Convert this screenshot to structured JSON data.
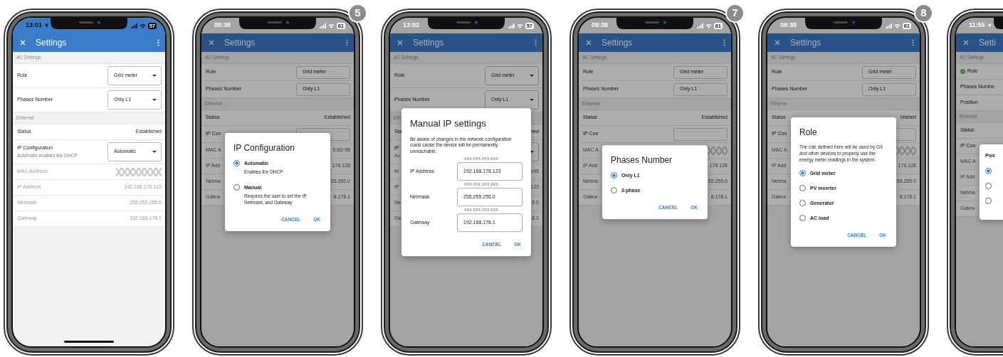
{
  "phones": [
    {
      "status_bar": {
        "time": "13:01",
        "location_arrow": true,
        "battery": "57"
      },
      "app_bar": {
        "title": "Settings"
      },
      "rows": [
        {
          "kind": "section",
          "label": "AC Settings"
        },
        {
          "kind": "dropdown",
          "label": "Role",
          "value": "Grid meter",
          "disabled": false
        },
        {
          "kind": "dropdown",
          "label": "Phases Number",
          "value": "Only L1",
          "disabled": false
        },
        {
          "kind": "section",
          "label": "Ethernet"
        },
        {
          "kind": "text",
          "label": "Status",
          "value": "Established",
          "disabled": false
        },
        {
          "kind": "dropdown",
          "label": "IP Configuration",
          "sublabel": "Automatic enables the DHCP",
          "value": "Automatic",
          "disabled": false
        },
        {
          "kind": "masked",
          "label": "MAC Address",
          "disabled": true
        },
        {
          "kind": "text",
          "label": "IP Address",
          "value": "192.168.178.123",
          "disabled": true
        },
        {
          "kind": "text",
          "label": "Netmask",
          "value": "255.255.255.0",
          "disabled": true
        },
        {
          "kind": "text",
          "label": "Gateway",
          "value": "192.168.178.1",
          "disabled": true
        }
      ]
    },
    {
      "step": "5",
      "status_bar": {
        "time": "09:38",
        "location_arrow": false,
        "battery": "61"
      },
      "app_bar": {
        "title": "Settings"
      },
      "rows": [
        {
          "kind": "section",
          "label": "AC Settings"
        },
        {
          "kind": "field",
          "label": "Role",
          "value": "Grid meter",
          "disabled": false
        },
        {
          "kind": "field",
          "label": "Phases Number",
          "value": "Only L1",
          "disabled": false
        },
        {
          "kind": "section",
          "label": "Ethernet"
        },
        {
          "kind": "text",
          "label": "Status",
          "value": "Established",
          "disabled": false
        },
        {
          "kind": "field",
          "label": "IP Con",
          "disabled": false
        },
        {
          "kind": "text",
          "label": "MAC A",
          "value": "5:8D:95",
          "disabled": true
        },
        {
          "kind": "text",
          "label": "IP Add",
          "value": "178.128",
          "disabled": true
        },
        {
          "kind": "text",
          "label": "Netma",
          "value": "55.255.0",
          "disabled": true
        },
        {
          "kind": "text",
          "label": "Gatew",
          "value": "8.178.1",
          "disabled": true
        }
      ],
      "dialog": {
        "kind": "radio",
        "title": "IP Configuration",
        "options": [
          {
            "label": "Automatic",
            "description": "Enables the DHCP",
            "selected": true
          },
          {
            "label": "Manual",
            "description": "Requires the user to set the IP, Netmask, and Gateway",
            "selected": false
          }
        ],
        "buttons": [
          "CANCEL",
          "OK"
        ]
      }
    },
    {
      "status_bar": {
        "time": "13:02",
        "location_arrow": false,
        "battery": "57"
      },
      "app_bar": {
        "title": "Settings"
      },
      "rows": [
        {
          "kind": "section",
          "label": "AC Settings"
        },
        {
          "kind": "dropdown",
          "label": "Role",
          "value": "Grid meter",
          "disabled": false
        },
        {
          "kind": "dropdown",
          "label": "Phases Number",
          "value": "Only L1",
          "disabled": false
        },
        {
          "kind": "section",
          "label": "Eth"
        },
        {
          "kind": "text",
          "label": "Sta",
          "value": "ned",
          "disabled": false
        },
        {
          "kind": "dropdown",
          "label": "IP",
          "sublabel": "Au",
          "disabled": false
        },
        {
          "kind": "text",
          "label": "M",
          "value": "x95",
          "disabled": true
        },
        {
          "kind": "text",
          "label": "IP",
          "value": "123",
          "disabled": true
        },
        {
          "kind": "text",
          "label": "Ne",
          "value": "5.0",
          "disabled": true
        },
        {
          "kind": "text",
          "label": "Ga",
          "value": "8.1",
          "disabled": true
        }
      ],
      "dialog": {
        "kind": "form",
        "title": "Manual IP settings",
        "description": "Be aware of changes in the network configuration could cause the device will be permanently unreachable.",
        "fields": [
          {
            "label": "IP Address",
            "placeholder": "xxx.xxx.xxx.xxx",
            "value": "192.168.178.123"
          },
          {
            "label": "Netmask",
            "placeholder": "xxx.xxx.xxx.xxx",
            "value": "255.255.255.0"
          },
          {
            "label": "Gateway",
            "placeholder": "xxx.xxx.xxx.xxx",
            "value": "192.168.178.1"
          }
        ],
        "buttons": [
          "CANCEL",
          "OK"
        ]
      }
    },
    {
      "step": "7",
      "status_bar": {
        "time": "09:38",
        "location_arrow": false,
        "battery": "61"
      },
      "app_bar": {
        "title": "Settings"
      },
      "rows": [
        {
          "kind": "section",
          "label": "AC Settings"
        },
        {
          "kind": "field",
          "label": "Role",
          "value": "Grid meter",
          "disabled": false
        },
        {
          "kind": "field",
          "label": "Phases Number",
          "value": "Only L1",
          "disabled": false
        },
        {
          "kind": "section",
          "label": "Ethernet"
        },
        {
          "kind": "text",
          "label": "Status",
          "value": "Established",
          "disabled": false
        },
        {
          "kind": "field",
          "label": "IP Con",
          "disabled": false
        },
        {
          "kind": "masked",
          "label": "MAC A",
          "disabled": true
        },
        {
          "kind": "text",
          "label": "IP Add",
          "value": "178.128",
          "disabled": true
        },
        {
          "kind": "text",
          "label": "Netma",
          "value": "55.255.0",
          "disabled": true
        },
        {
          "kind": "text",
          "label": "Gatew",
          "value": "8.178.1",
          "disabled": true
        }
      ],
      "dialog": {
        "kind": "radio",
        "title": "Phases Number",
        "options": [
          {
            "label": "Only L1",
            "selected": true
          },
          {
            "label": "3-phase",
            "selected": false
          }
        ],
        "buttons": [
          "CANCEL",
          "OK"
        ]
      }
    },
    {
      "step": "8",
      "status_bar": {
        "time": "09:38",
        "location_arrow": false,
        "battery": "61"
      },
      "app_bar": {
        "title": "Settings"
      },
      "rows": [
        {
          "kind": "section",
          "label": "AC Settings"
        },
        {
          "kind": "field",
          "label": "Role",
          "value": "Grid meter",
          "disabled": false
        },
        {
          "kind": "field",
          "label": "Phases Number",
          "value": "Only L1",
          "disabled": false
        },
        {
          "kind": "section",
          "label": "Etherne"
        },
        {
          "kind": "text",
          "label": "Status",
          "value": "blished",
          "disabled": false
        },
        {
          "kind": "field",
          "label": "IP Con",
          "disabled": false
        },
        {
          "kind": "masked",
          "label": "MAC A",
          "disabled": true
        },
        {
          "kind": "text",
          "label": "IP Add",
          "value": "178.128",
          "disabled": true
        },
        {
          "kind": "text",
          "label": "Netma",
          "value": "55.255.0",
          "disabled": true
        },
        {
          "kind": "text",
          "label": "Gatew",
          "value": "8.178.1",
          "disabled": true
        }
      ],
      "dialog": {
        "kind": "radio",
        "title": "Role",
        "description": "The role defined here will be used by GX and other devices to properly use the energy meter readings in the system.",
        "options": [
          {
            "label": "Grid meter",
            "selected": true
          },
          {
            "label": "PV inverter",
            "selected": false
          },
          {
            "label": "Generator",
            "selected": false
          },
          {
            "label": "AC load",
            "selected": false
          }
        ],
        "buttons": [
          "CANCEL",
          "OK"
        ]
      }
    },
    {
      "status_bar": {
        "time": "11:55",
        "location_arrow": true
      },
      "app_bar": {
        "title": "Setti"
      },
      "rows": [
        {
          "kind": "section",
          "label": "AC Settings"
        },
        {
          "kind": "text",
          "label": "Role",
          "verified": true,
          "disabled": false
        },
        {
          "kind": "text",
          "label": "Phases Numbe",
          "verified": false,
          "disabled": false
        },
        {
          "kind": "text",
          "label": "Position",
          "verified": false,
          "disabled": false
        },
        {
          "kind": "section",
          "label": "Ethernet"
        },
        {
          "kind": "text",
          "label": "Status",
          "verified": false,
          "disabled": false
        },
        {
          "kind": "text",
          "label": "IP Con",
          "verified": false,
          "disabled": false
        },
        {
          "kind": "text",
          "label": "MAC A",
          "verified": false,
          "disabled": true
        },
        {
          "kind": "text",
          "label": "IP Add",
          "verified": false,
          "disabled": true
        },
        {
          "kind": "text",
          "label": "Netma",
          "verified": false,
          "disabled": true
        },
        {
          "kind": "text",
          "label": "Gatew",
          "verified": false,
          "disabled": true
        }
      ],
      "dialog": {
        "kind": "picker",
        "title": "Pos",
        "options": [
          {
            "selected": true
          },
          {
            "selected": false
          },
          {
            "selected": false
          }
        ]
      }
    }
  ]
}
